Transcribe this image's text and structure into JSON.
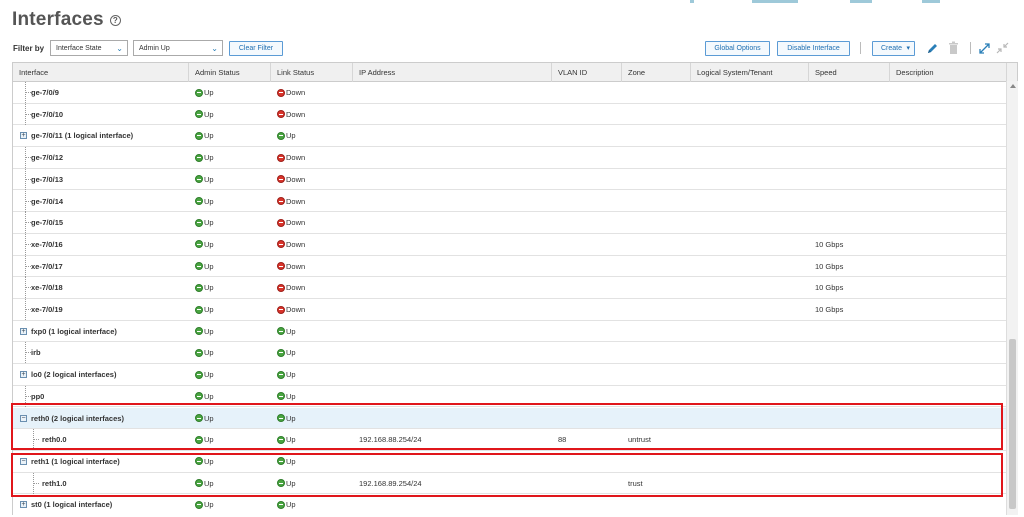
{
  "header": {
    "title": "Interfaces",
    "help_icon": "?"
  },
  "filter": {
    "label": "Filter by",
    "field_value": "Interface State",
    "state_value": "Admin Up",
    "clear_label": "Clear Filter"
  },
  "toolbar": {
    "global_options": "Global Options",
    "disable_interface": "Disable Interface",
    "create": "Create",
    "create_caret": "▾"
  },
  "columns": [
    "Interface",
    "Admin Status",
    "Link Status",
    "IP Address",
    "VLAN ID",
    "Zone",
    "Logical System/Tenant",
    "Speed",
    "Description"
  ],
  "rows": [
    {
      "interface": "ge-7/0/9",
      "admin": "Up",
      "link": "Down",
      "ip": "",
      "vlan": "",
      "zone": "",
      "speed": ""
    },
    {
      "interface": "ge-7/0/10",
      "admin": "Up",
      "link": "Down",
      "ip": "",
      "vlan": "",
      "zone": "",
      "speed": ""
    },
    {
      "interface": "ge-7/0/11 (1 logical interface)",
      "admin": "Up",
      "link": "Up",
      "ip": "",
      "vlan": "",
      "zone": "",
      "speed": "",
      "expander": "+"
    },
    {
      "interface": "ge-7/0/12",
      "admin": "Up",
      "link": "Down",
      "ip": "",
      "vlan": "",
      "zone": "",
      "speed": ""
    },
    {
      "interface": "ge-7/0/13",
      "admin": "Up",
      "link": "Down",
      "ip": "",
      "vlan": "",
      "zone": "",
      "speed": ""
    },
    {
      "interface": "ge-7/0/14",
      "admin": "Up",
      "link": "Down",
      "ip": "",
      "vlan": "",
      "zone": "",
      "speed": ""
    },
    {
      "interface": "ge-7/0/15",
      "admin": "Up",
      "link": "Down",
      "ip": "",
      "vlan": "",
      "zone": "",
      "speed": ""
    },
    {
      "interface": "xe-7/0/16",
      "admin": "Up",
      "link": "Down",
      "ip": "",
      "vlan": "",
      "zone": "",
      "speed": "10 Gbps"
    },
    {
      "interface": "xe-7/0/17",
      "admin": "Up",
      "link": "Down",
      "ip": "",
      "vlan": "",
      "zone": "",
      "speed": "10 Gbps"
    },
    {
      "interface": "xe-7/0/18",
      "admin": "Up",
      "link": "Down",
      "ip": "",
      "vlan": "",
      "zone": "",
      "speed": "10 Gbps"
    },
    {
      "interface": "xe-7/0/19",
      "admin": "Up",
      "link": "Down",
      "ip": "",
      "vlan": "",
      "zone": "",
      "speed": "10 Gbps"
    },
    {
      "interface": "fxp0 (1 logical interface)",
      "admin": "Up",
      "link": "Up",
      "ip": "",
      "vlan": "",
      "zone": "",
      "speed": "",
      "expander": "+"
    },
    {
      "interface": "irb",
      "admin": "Up",
      "link": "Up",
      "ip": "",
      "vlan": "",
      "zone": "",
      "speed": ""
    },
    {
      "interface": "lo0 (2 logical interfaces)",
      "admin": "Up",
      "link": "Up",
      "ip": "",
      "vlan": "",
      "zone": "",
      "speed": "",
      "expander": "+"
    },
    {
      "interface": "pp0",
      "admin": "Up",
      "link": "Up",
      "ip": "",
      "vlan": "",
      "zone": "",
      "speed": ""
    },
    {
      "interface": "reth0 (2 logical interfaces)",
      "admin": "Up",
      "link": "Up",
      "ip": "",
      "vlan": "",
      "zone": "",
      "speed": "",
      "expander": "−"
    },
    {
      "interface": "reth0.0",
      "admin": "Up",
      "link": "Up",
      "ip": "192.168.88.254/24",
      "vlan": "88",
      "zone": "untrust",
      "speed": ""
    },
    {
      "interface": "reth1 (1 logical interface)",
      "admin": "Up",
      "link": "Up",
      "ip": "",
      "vlan": "",
      "zone": "",
      "speed": "",
      "expander": "−"
    },
    {
      "interface": "reth1.0",
      "admin": "Up",
      "link": "Up",
      "ip": "192.168.89.254/24",
      "vlan": "",
      "zone": "trust",
      "speed": ""
    },
    {
      "interface": "st0 (1 logical interface)",
      "admin": "Up",
      "link": "Up",
      "ip": "",
      "vlan": "",
      "zone": "",
      "speed": "",
      "expander": "+"
    }
  ],
  "selected_row": 15,
  "child_rows": [
    16,
    18
  ],
  "colors": {
    "accent": "#1f6fb2",
    "up": "#4aa541",
    "down": "#d9342b",
    "highlight": "#e0161b",
    "selected": "#e6f2fa"
  }
}
